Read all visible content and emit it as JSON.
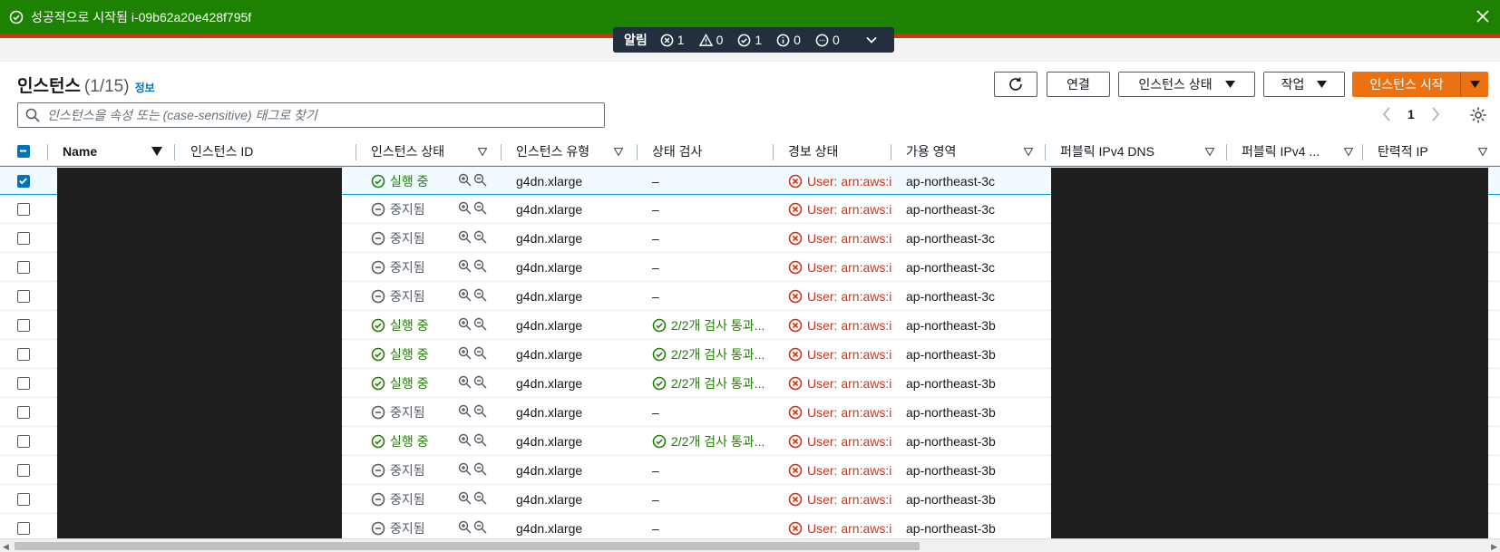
{
  "flash": {
    "message": "성공적으로 시작됨 i-09b62a20e428f795f"
  },
  "notifications": {
    "label": "알림",
    "error_count": "1",
    "warning_count": "0",
    "success_count": "1",
    "info_count": "0",
    "pending_count": "0"
  },
  "header": {
    "title": "인스턴스",
    "count": "(1/15)",
    "info_link": "정보"
  },
  "toolbar": {
    "connect": "연결",
    "instance_state": "인스턴스 상태",
    "actions": "작업",
    "launch": "인스턴스 시작"
  },
  "search": {
    "placeholder": "인스턴스을 속성 또는 (case-sensitive) 태그로 찾기"
  },
  "pagination": {
    "page": "1"
  },
  "columns": {
    "name": "Name",
    "instance_id": "인스턴스 ID",
    "instance_state": "인스턴스 상태",
    "instance_type": "인스턴스 유형",
    "status_check": "상태 검사",
    "alarm_status": "경보 상태",
    "availability_zone": "가용 영역",
    "public_dns": "퍼블릭 IPv4 DNS",
    "public_ip": "퍼블릭 IPv4 ...",
    "elastic_ip": "탄력적 IP"
  },
  "rows": [
    {
      "state": "실행 중",
      "running": true,
      "type": "g4dn.xlarge",
      "check": "–",
      "alarm": "User: arn:aws:i",
      "az": "ap-northeast-3c",
      "selected": true
    },
    {
      "state": "중지됨",
      "running": false,
      "type": "g4dn.xlarge",
      "check": "–",
      "alarm": "User: arn:aws:i",
      "az": "ap-northeast-3c",
      "selected": false
    },
    {
      "state": "중지됨",
      "running": false,
      "type": "g4dn.xlarge",
      "check": "–",
      "alarm": "User: arn:aws:i",
      "az": "ap-northeast-3c",
      "selected": false
    },
    {
      "state": "중지됨",
      "running": false,
      "type": "g4dn.xlarge",
      "check": "–",
      "alarm": "User: arn:aws:i",
      "az": "ap-northeast-3c",
      "selected": false
    },
    {
      "state": "중지됨",
      "running": false,
      "type": "g4dn.xlarge",
      "check": "–",
      "alarm": "User: arn:aws:i",
      "az": "ap-northeast-3c",
      "selected": false
    },
    {
      "state": "실행 중",
      "running": true,
      "type": "g4dn.xlarge",
      "check": "2/2개 검사 통과...",
      "alarm": "User: arn:aws:i",
      "az": "ap-northeast-3b",
      "selected": false
    },
    {
      "state": "실행 중",
      "running": true,
      "type": "g4dn.xlarge",
      "check": "2/2개 검사 통과...",
      "alarm": "User: arn:aws:i",
      "az": "ap-northeast-3b",
      "selected": false
    },
    {
      "state": "실행 중",
      "running": true,
      "type": "g4dn.xlarge",
      "check": "2/2개 검사 통과...",
      "alarm": "User: arn:aws:i",
      "az": "ap-northeast-3b",
      "selected": false
    },
    {
      "state": "중지됨",
      "running": false,
      "type": "g4dn.xlarge",
      "check": "–",
      "alarm": "User: arn:aws:i",
      "az": "ap-northeast-3b",
      "selected": false
    },
    {
      "state": "실행 중",
      "running": true,
      "type": "g4dn.xlarge",
      "check": "2/2개 검사 통과...",
      "alarm": "User: arn:aws:i",
      "az": "ap-northeast-3b",
      "selected": false
    },
    {
      "state": "중지됨",
      "running": false,
      "type": "g4dn.xlarge",
      "check": "–",
      "alarm": "User: arn:aws:i",
      "az": "ap-northeast-3b",
      "selected": false
    },
    {
      "state": "중지됨",
      "running": false,
      "type": "g4dn.xlarge",
      "check": "–",
      "alarm": "User: arn:aws:i",
      "az": "ap-northeast-3b",
      "selected": false
    },
    {
      "state": "중지됨",
      "running": false,
      "type": "g4dn.xlarge",
      "check": "–",
      "alarm": "User: arn:aws:i",
      "az": "ap-northeast-3b",
      "selected": false
    }
  ],
  "colors": {
    "success": "#1d8102",
    "error": "#d13212",
    "primary": "#ec7211",
    "link": "#0073bb"
  }
}
